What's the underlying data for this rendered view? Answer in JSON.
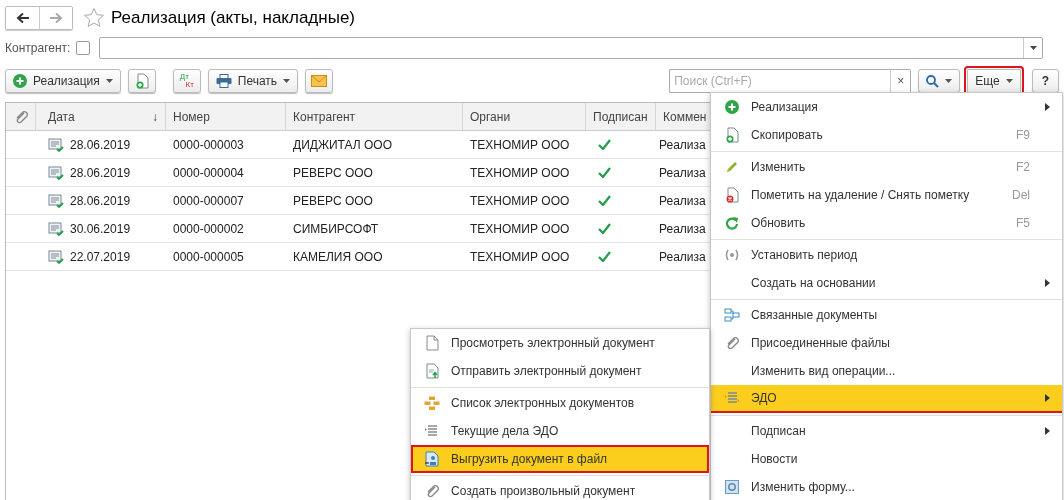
{
  "window": {
    "title": "Реализация (акты, накладные)"
  },
  "filter": {
    "label": "Контрагент:",
    "checked": false
  },
  "toolbar": {
    "create_button": "Реализация",
    "dt_kt": {
      "top": "Дт",
      "bottom": "Кт"
    },
    "print_button": "Печать",
    "search": {
      "placeholder": "Поиск (Ctrl+F)"
    },
    "clear": "×",
    "more_button": {
      "label": "Еще",
      "outlined": true
    },
    "help_button": "?"
  },
  "table": {
    "columns": [
      "Дата",
      "Номер",
      "Контрагент",
      "Органи",
      "Подписан",
      "Коммен"
    ],
    "sort_mark": "↓",
    "rows": [
      {
        "date": "28.06.2019",
        "number": "0000-000003",
        "counterparty": "ДИДЖИТАЛ ООО",
        "organization": "ТЕХНОМИР ООО",
        "signed": true,
        "comment": "Реализа"
      },
      {
        "date": "28.06.2019",
        "number": "0000-000004",
        "counterparty": "РЕВЕРС ООО",
        "organization": "ТЕХНОМИР ООО",
        "signed": true,
        "comment": "Реализа"
      },
      {
        "date": "28.06.2019",
        "number": "0000-000007",
        "counterparty": "РЕВЕРС ООО",
        "organization": "ТЕХНОМИР ООО",
        "signed": true,
        "comment": "Реализа"
      },
      {
        "date": "30.06.2019",
        "number": "0000-000002",
        "counterparty": "СИМБИРСОФТ",
        "organization": "ТЕХНОМИР ООО",
        "signed": true,
        "comment": "Реализа"
      },
      {
        "date": "22.07.2019",
        "number": "0000-000005",
        "counterparty": "КАМЕЛИЯ ООО",
        "organization": "ТЕХНОМИР ООО",
        "signed": true,
        "comment": "Реализа"
      }
    ]
  },
  "menu": {
    "items": [
      {
        "kind": "command",
        "label": "Реализация",
        "submenu": true,
        "selected": false
      },
      {
        "kind": "command",
        "label": "Скопировать",
        "shortcut": "F9",
        "selected": false
      },
      {
        "kind": "separator"
      },
      {
        "kind": "command",
        "label": "Изменить",
        "shortcut": "F2",
        "selected": false
      },
      {
        "kind": "command",
        "label": "Пометить на удаление / Снять пометку",
        "shortcut": "Del",
        "selected": false
      },
      {
        "kind": "command",
        "label": "Обновить",
        "shortcut": "F5",
        "selected": false
      },
      {
        "kind": "separator"
      },
      {
        "kind": "command",
        "label": "Установить период",
        "selected": false
      },
      {
        "kind": "command",
        "label": "Создать на основании",
        "submenu": true,
        "selected": false
      },
      {
        "kind": "separator"
      },
      {
        "kind": "command",
        "label": "Связанные документы",
        "selected": false
      },
      {
        "kind": "command",
        "label": "Присоединенные файлы",
        "selected": false
      },
      {
        "kind": "command",
        "label": "Изменить вид операции...",
        "selected": false
      },
      {
        "kind": "command",
        "label": "ЭДО",
        "submenu": true,
        "selected": true
      },
      {
        "kind": "separator"
      },
      {
        "kind": "command",
        "label": "Подписан",
        "submenu": true,
        "selected": false
      },
      {
        "kind": "command",
        "label": "Новости",
        "selected": false
      },
      {
        "kind": "command",
        "label": "Изменить форму...",
        "selected": false
      }
    ]
  },
  "submenu": {
    "items": [
      {
        "kind": "command",
        "label": "Просмотреть электронный документ",
        "selected": false,
        "outlined": false
      },
      {
        "kind": "command",
        "label": "Отправить электронный документ",
        "selected": false,
        "outlined": false
      },
      {
        "kind": "separator"
      },
      {
        "kind": "command",
        "label": "Список электронных документов",
        "selected": false,
        "outlined": false
      },
      {
        "kind": "command",
        "label": "Текущие дела ЭДО",
        "selected": false,
        "outlined": false
      },
      {
        "kind": "command",
        "label": "Выгрузить документ в файл",
        "selected": true,
        "outlined": true
      },
      {
        "kind": "separator"
      },
      {
        "kind": "command",
        "label": "Создать произвольный документ",
        "selected": false,
        "outlined": false
      }
    ]
  }
}
